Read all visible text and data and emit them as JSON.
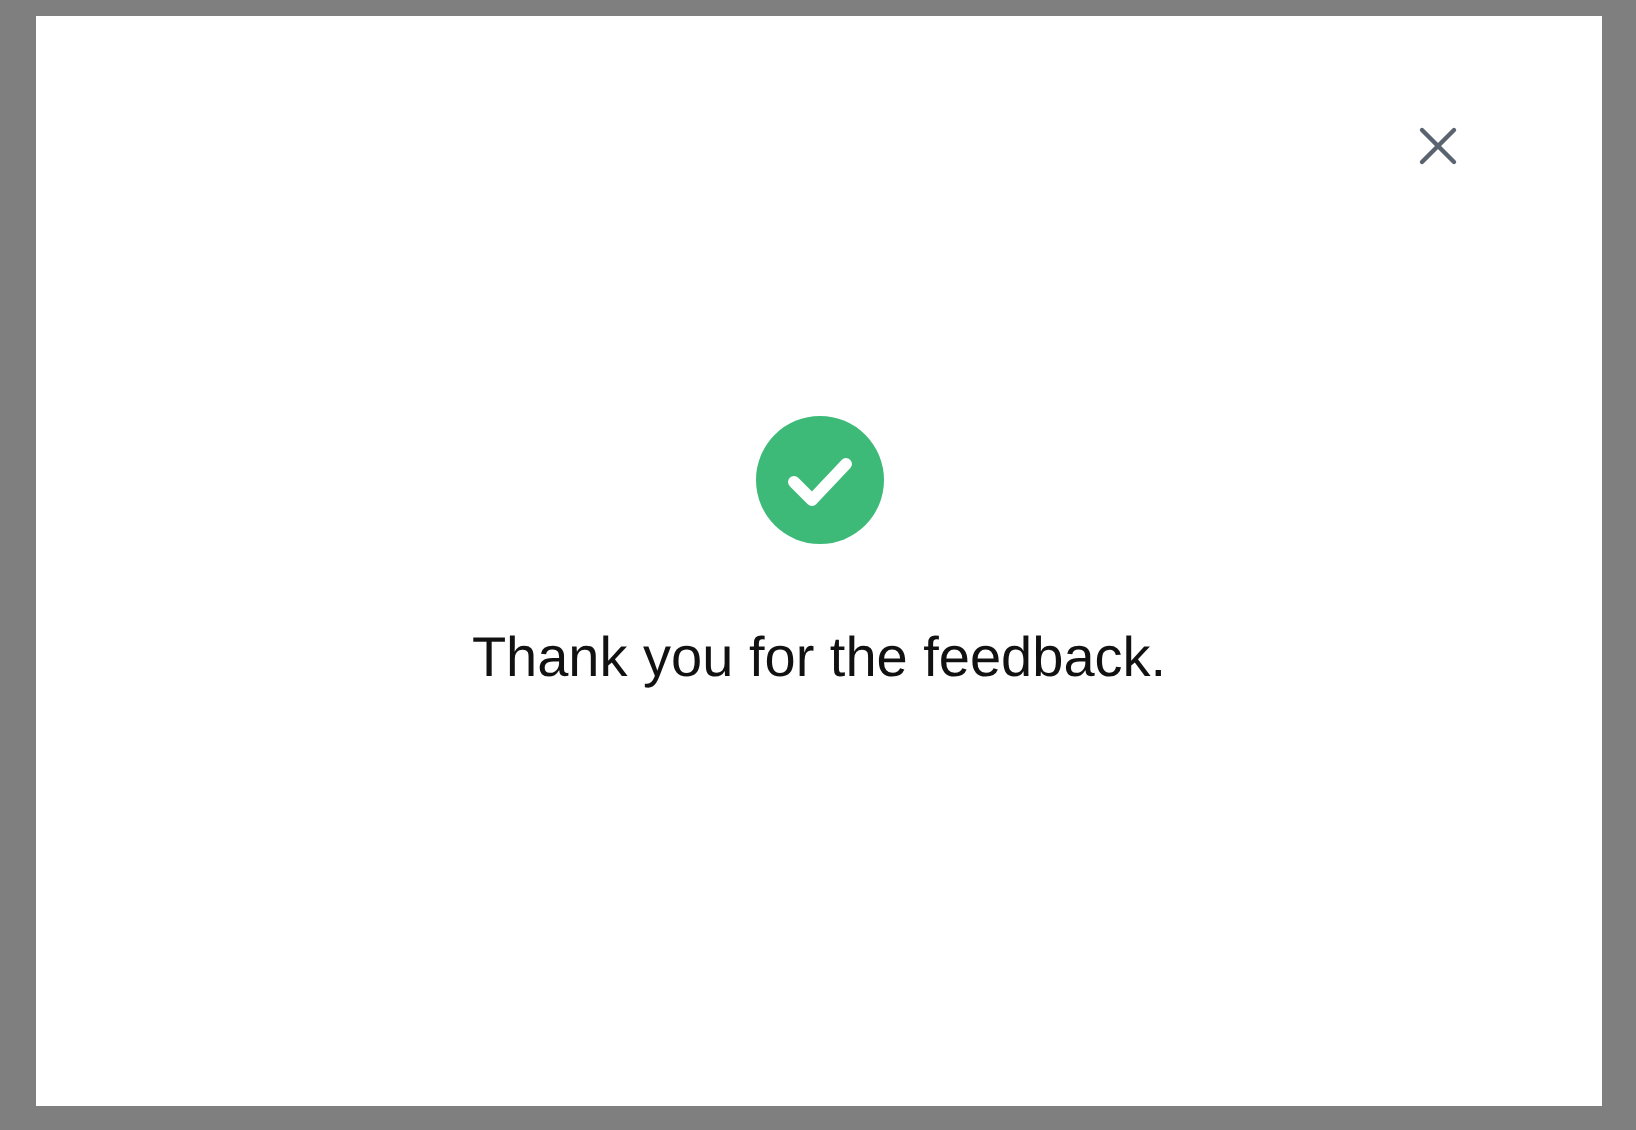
{
  "dialog": {
    "message": "Thank you for the feedback."
  }
}
